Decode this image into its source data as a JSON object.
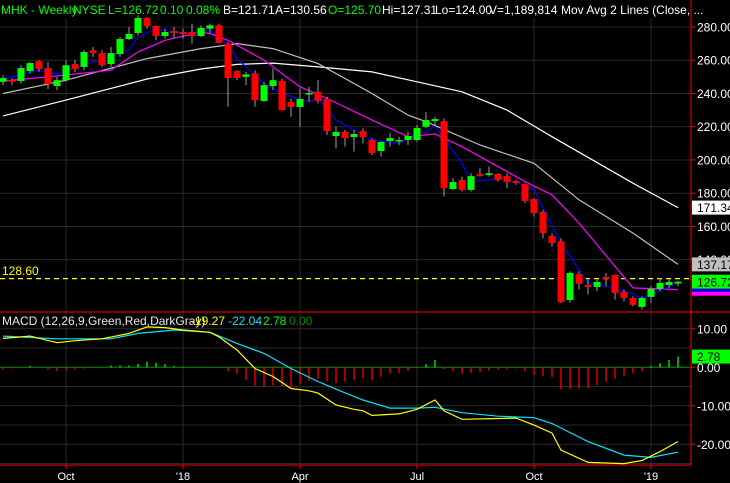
{
  "header": {
    "symbol": "MHK - Weekly",
    "exchange": "NYSE",
    "last": "L=126.72",
    "change": "0.10",
    "change_pct": "0.08%",
    "bid": "B=121.71",
    "ask": "A=130.56",
    "open": "O=125.70",
    "high": "Hi=127.31",
    "low": "Lo=124.00",
    "volume": "V=1,189,814",
    "study": "Mov Avg 2 Lines (Close, ..."
  },
  "macd_header": {
    "label": "MACD (12,26,9,Green,Red,DarkGray)",
    "macd": "-19.27",
    "signal": "-22.04",
    "histogram": "2.78",
    "zero": "0.00"
  },
  "colors": {
    "background": "#000000",
    "up": "#00ff00",
    "down": "#ff0000",
    "wick": "#a0a0a0",
    "grid": "#2a2a2a",
    "axis": "#ff0000",
    "ma_fast": "#0000ff",
    "ma_mid": "#ff00ff",
    "ma_slow": "#c0c0c0",
    "ma_slowest": "#ffffff",
    "macd": "#ffff00",
    "signal": "#00e5ff",
    "reference": "#ffff00"
  },
  "chart_data": [
    {
      "type": "candlestick",
      "panel": "price",
      "ylim": [
        110,
        290
      ],
      "y_ticks": [
        "280.00",
        "260.00",
        "240.00",
        "220.00",
        "200.00",
        "180.00",
        "160.00",
        "140.00"
      ],
      "y_tick_values": [
        280,
        260,
        240,
        220,
        200,
        180,
        160,
        140
      ],
      "x_labels": [
        {
          "week": 7,
          "label": "Oct"
        },
        {
          "week": 20,
          "label": "'18"
        },
        {
          "week": 33,
          "label": "Apr"
        },
        {
          "week": 46,
          "label": "Jul"
        },
        {
          "week": 59,
          "label": "Oct"
        },
        {
          "week": 72,
          "label": "'19"
        }
      ],
      "ohlc_fields": [
        "open",
        "high",
        "low",
        "close"
      ],
      "candles": [
        [
          247.0,
          251,
          245,
          249.3
        ],
        [
          248,
          249,
          245,
          247
        ],
        [
          247.5,
          257,
          246,
          255.3
        ],
        [
          253.5,
          259,
          252,
          258.3
        ],
        [
          259.5,
          260,
          253,
          254.7
        ],
        [
          255.3,
          259,
          242.7,
          245.7
        ],
        [
          244.5,
          250,
          242,
          248
        ],
        [
          248,
          260,
          247,
          257
        ],
        [
          257.7,
          260,
          253,
          254.7
        ],
        [
          256,
          266,
          254,
          265
        ],
        [
          266,
          268,
          262,
          264.3
        ],
        [
          264.3,
          266,
          256,
          257
        ],
        [
          257.7,
          268,
          256,
          264.3
        ],
        [
          263.7,
          274,
          262,
          272.8
        ],
        [
          272.8,
          280,
          272,
          275.8
        ],
        [
          276.4,
          287,
          275,
          285.4
        ],
        [
          285.4,
          286,
          279,
          280.6
        ],
        [
          280.6,
          281,
          272,
          274.6
        ],
        [
          274.6,
          279,
          273,
          277
        ],
        [
          277.6,
          280,
          273,
          276.4
        ],
        [
          277,
          279,
          273,
          275.8
        ],
        [
          277,
          282,
          270,
          274.6
        ],
        [
          274.6,
          281,
          274,
          279.4
        ],
        [
          279,
          282,
          276,
          281
        ],
        [
          281,
          282,
          270,
          270.4
        ],
        [
          270,
          271,
          232,
          249.3
        ],
        [
          253.5,
          254,
          248,
          249.3
        ],
        [
          250,
          253,
          245,
          251.5
        ],
        [
          252,
          254,
          232,
          236
        ],
        [
          235.5,
          247,
          235,
          245
        ],
        [
          244.5,
          255,
          242,
          248
        ],
        [
          247.5,
          249,
          230,
          230
        ],
        [
          234.9,
          237,
          226,
          231.9
        ],
        [
          231.9,
          243,
          220,
          236.7
        ],
        [
          239.7,
          244,
          235,
          240.3
        ],
        [
          241,
          248,
          234,
          235.5
        ],
        [
          236.7,
          238,
          215,
          217.4
        ],
        [
          214.4,
          220,
          207,
          216.8
        ],
        [
          216.8,
          218,
          208,
          213.2
        ],
        [
          213.8,
          218,
          205,
          215.6
        ],
        [
          217.4,
          219,
          210,
          213.8
        ],
        [
          212,
          213,
          203,
          204.2
        ],
        [
          205.4,
          211,
          202,
          210.8
        ],
        [
          211.4,
          216,
          208,
          213.2
        ],
        [
          211.4,
          214,
          209,
          212
        ],
        [
          212,
          217,
          209,
          214.4
        ],
        [
          212,
          221,
          211,
          219.2
        ],
        [
          220,
          229,
          219,
          224
        ],
        [
          223.4,
          226,
          221,
          224.6
        ],
        [
          223.4,
          225,
          178,
          183.1
        ],
        [
          182.5,
          189,
          182,
          186.7
        ],
        [
          188,
          190,
          181,
          182
        ],
        [
          182,
          192,
          181,
          190.3
        ],
        [
          191.5,
          195,
          190,
          190.3
        ],
        [
          191,
          196,
          190,
          192
        ],
        [
          191.5,
          192,
          187,
          188
        ],
        [
          190.3,
          192,
          183,
          186.7
        ],
        [
          187.3,
          188,
          185,
          186.1
        ],
        [
          185.5,
          186,
          174,
          175.3
        ],
        [
          176.5,
          177,
          166,
          168
        ],
        [
          168.7,
          170,
          153,
          156
        ],
        [
          154.3,
          156,
          148,
          150
        ],
        [
          151,
          153,
          114,
          114.5
        ],
        [
          115.7,
          133,
          114,
          132
        ],
        [
          131.4,
          133,
          122,
          125.4
        ],
        [
          124.8,
          128,
          119,
          123.6
        ],
        [
          123.6,
          128,
          121,
          126.6
        ],
        [
          129.6,
          132,
          124,
          128.4
        ],
        [
          130.8,
          131,
          116,
          120
        ],
        [
          120.6,
          122,
          115,
          117
        ],
        [
          117,
          118,
          112,
          112.8
        ],
        [
          111.6,
          118,
          110,
          117
        ],
        [
          117.6,
          124,
          114,
          122.4
        ],
        [
          122.4,
          129,
          121,
          126
        ],
        [
          124.8,
          128,
          123,
          126.6
        ],
        [
          125.7,
          127.31,
          124,
          126.72
        ]
      ],
      "reference_line": {
        "value": 128.6,
        "label": "128.60"
      },
      "moving_averages": [
        {
          "key": "ma_fast",
          "points": [
            [
              0,
              248.7
            ],
            [
              4,
              254
            ],
            [
              6,
              251.7
            ],
            [
              9,
              257
            ],
            [
              11,
              260.7
            ],
            [
              14,
              266
            ],
            [
              15,
              274
            ],
            [
              17,
              279
            ],
            [
              19,
              277
            ],
            [
              21,
              276
            ],
            [
              23,
              278
            ],
            [
              25,
              270
            ],
            [
              26,
              261
            ],
            [
              29,
              246
            ],
            [
              31,
              240
            ],
            [
              34,
              235
            ],
            [
              35,
              237
            ],
            [
              37,
              224
            ],
            [
              41,
              212
            ],
            [
              44,
              210
            ],
            [
              48,
              220
            ],
            [
              51,
              198
            ],
            [
              52,
              187
            ],
            [
              56,
              189
            ],
            [
              59,
              182
            ],
            [
              62,
              150
            ],
            [
              65,
              126
            ],
            [
              68,
              123
            ],
            [
              71,
              117
            ],
            [
              75,
              126
            ]
          ]
        },
        {
          "key": "ma_mid",
          "points": [
            [
              0,
              247.5
            ],
            [
              5,
              250
            ],
            [
              12,
              254
            ],
            [
              15,
              265
            ],
            [
              18,
              272
            ],
            [
              22,
              277
            ],
            [
              23,
              276
            ],
            [
              25,
              272
            ],
            [
              29,
              260
            ],
            [
              33,
              244
            ],
            [
              36,
              237
            ],
            [
              41,
              224
            ],
            [
              45,
              214
            ],
            [
              48,
              215.6
            ],
            [
              51,
              208
            ],
            [
              58,
              187
            ],
            [
              61,
              179
            ],
            [
              64,
              162
            ],
            [
              70,
              123
            ],
            [
              73,
              122.4
            ],
            [
              75,
              122
            ]
          ]
        },
        {
          "key": "ma_slow",
          "points": [
            [
              0,
              240
            ],
            [
              7,
              248
            ],
            [
              16,
              261
            ],
            [
              22,
              267
            ],
            [
              26,
              270
            ],
            [
              30,
              267
            ],
            [
              35,
              258
            ],
            [
              41,
              240
            ],
            [
              45,
              227
            ],
            [
              47,
              223
            ],
            [
              53,
              209
            ],
            [
              59,
              198
            ],
            [
              64,
              176
            ],
            [
              70,
              156
            ],
            [
              75,
              137.17
            ]
          ]
        },
        {
          "key": "ma_slowest",
          "points": [
            [
              0,
              226.5
            ],
            [
              7,
              236
            ],
            [
              16,
              248.7
            ],
            [
              22,
              254.7
            ],
            [
              26,
              257.5
            ],
            [
              30,
              258.3
            ],
            [
              35,
              256
            ],
            [
              41,
              253
            ],
            [
              46,
              247
            ],
            [
              51,
              241
            ],
            [
              56,
              230
            ],
            [
              61,
              214
            ],
            [
              70,
              186
            ],
            [
              75,
              171.34
            ]
          ]
        }
      ],
      "last_value_labels": [
        {
          "label": "171.34",
          "value": 171.34,
          "key": "ma_slowest"
        },
        {
          "label": "137.17",
          "value": 137.17,
          "key": "ma_slow"
        },
        {
          "label": "126.72",
          "value": 126.72,
          "key": "up"
        }
      ]
    },
    {
      "type": "line",
      "panel": "macd",
      "ylim": [
        -25,
        11
      ],
      "y_ticks": [
        "10.00",
        "0.00",
        "-10.00",
        "-20.00"
      ],
      "y_tick_values": [
        10,
        0,
        -10,
        -20
      ],
      "series": [
        {
          "key": "macd",
          "points": [
            [
              0,
              7.5
            ],
            [
              3,
              8.1
            ],
            [
              6,
              6.4
            ],
            [
              8,
              6.9
            ],
            [
              11,
              7.4
            ],
            [
              14,
              8.8
            ],
            [
              16,
              10.5
            ],
            [
              18,
              10.3
            ],
            [
              20,
              9.7
            ],
            [
              23,
              9.1
            ],
            [
              24,
              7.9
            ],
            [
              26,
              4.5
            ],
            [
              28,
              -0.3
            ],
            [
              30,
              -2.4
            ],
            [
              32,
              -5.5
            ],
            [
              34,
              -6.1
            ],
            [
              35,
              -6.7
            ],
            [
              37,
              -9.8
            ],
            [
              39,
              -10.9
            ],
            [
              40,
              -11.3
            ],
            [
              41,
              -12.5
            ],
            [
              44,
              -12.1
            ],
            [
              46,
              -10.9
            ],
            [
              48,
              -8.5
            ],
            [
              49,
              -11.3
            ],
            [
              51,
              -13.5
            ],
            [
              55,
              -13.3
            ],
            [
              57,
              -13.2
            ],
            [
              59,
              -15
            ],
            [
              61,
              -17.1
            ],
            [
              62,
              -21.5
            ],
            [
              65,
              -24.7
            ],
            [
              69,
              -25
            ],
            [
              71,
              -24.2
            ],
            [
              73,
              -21.9
            ],
            [
              75,
              -19.27
            ]
          ]
        },
        {
          "key": "signal",
          "points": [
            [
              0,
              8.1
            ],
            [
              6,
              7.4
            ],
            [
              12,
              7.4
            ],
            [
              15,
              8.8
            ],
            [
              19,
              9.7
            ],
            [
              23,
              9.1
            ],
            [
              26,
              6.2
            ],
            [
              29,
              3.6
            ],
            [
              32,
              -0.3
            ],
            [
              35,
              -3.7
            ],
            [
              37,
              -5.7
            ],
            [
              40,
              -8.5
            ],
            [
              43,
              -10.6
            ],
            [
              46,
              -10.6
            ],
            [
              48,
              -10.4
            ],
            [
              51,
              -11.8
            ],
            [
              55,
              -12.7
            ],
            [
              59,
              -13.1
            ],
            [
              61,
              -14.6
            ],
            [
              65,
              -19.3
            ],
            [
              69,
              -22.8
            ],
            [
              72,
              -23.4
            ],
            [
              75,
              -22.04
            ]
          ]
        }
      ],
      "histogram": "macd minus signal",
      "last_value_labels": [
        {
          "label": "2.78",
          "value": 2.78
        }
      ]
    }
  ]
}
